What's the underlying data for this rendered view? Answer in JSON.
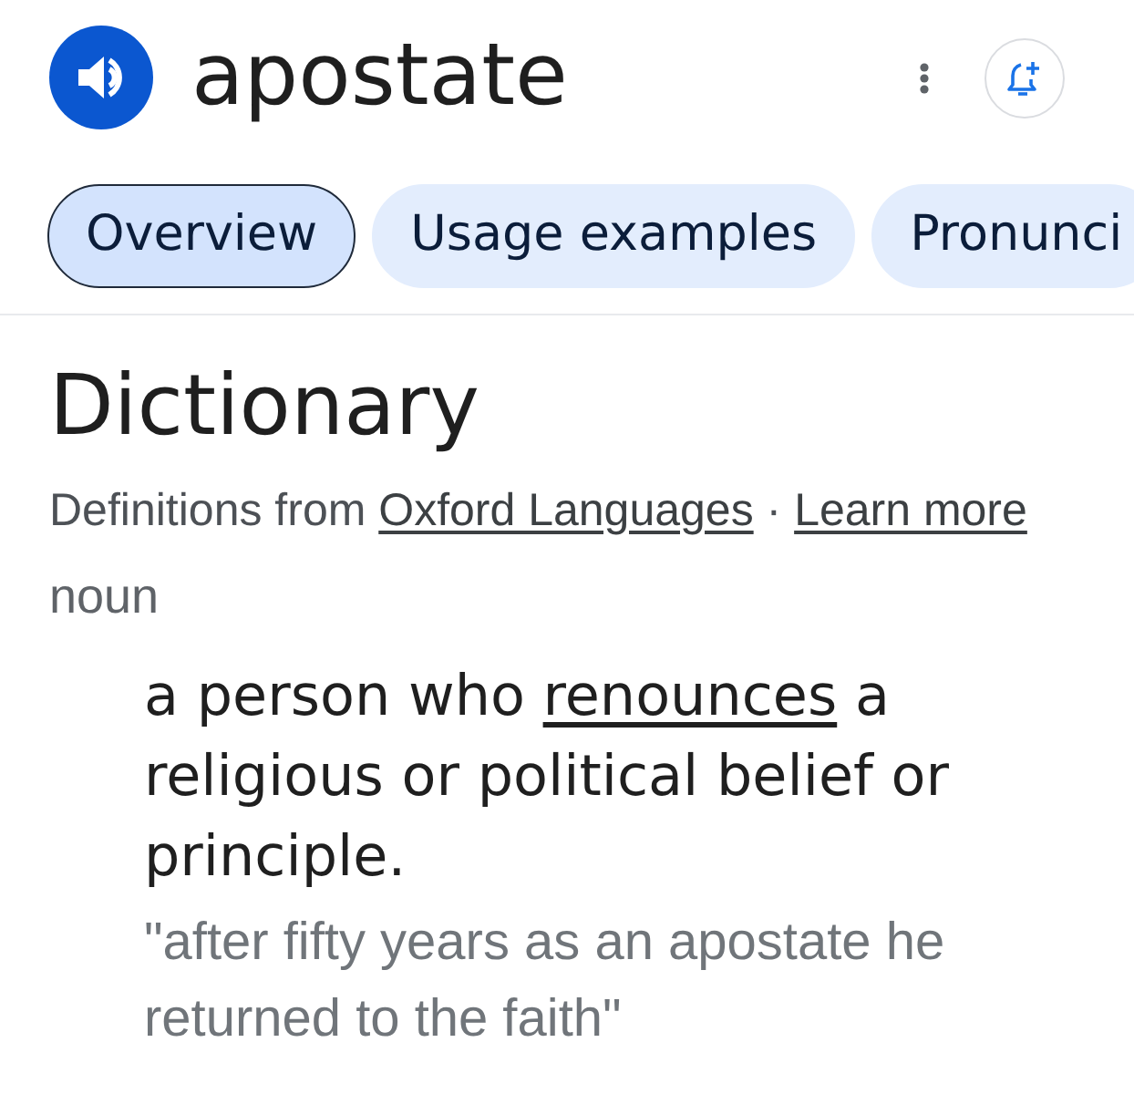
{
  "header": {
    "word": "apostate"
  },
  "tabs": [
    {
      "label": "Overview",
      "selected": true
    },
    {
      "label": "Usage examples",
      "selected": false
    },
    {
      "label": "Pronunci",
      "selected": false
    }
  ],
  "section": {
    "title": "Dictionary",
    "source": [
      {
        "text": "Definitions from",
        "kind": "plain"
      },
      {
        "text": "Oxford Languages",
        "kind": "link"
      },
      {
        "text": "·",
        "kind": "plain"
      },
      {
        "text": "Learn more",
        "kind": "link"
      }
    ]
  },
  "entry": {
    "part_of_speech": "noun",
    "definitions": [
      {
        "parts": [
          {
            "text": "a person who",
            "kind": "plain"
          },
          {
            "text": "renounces",
            "kind": "link"
          },
          {
            "text": "a religious or political belief or principle.",
            "kind": "plain"
          }
        ],
        "example": "\"after fifty years as an apostate he returned to the faith\""
      }
    ]
  }
}
